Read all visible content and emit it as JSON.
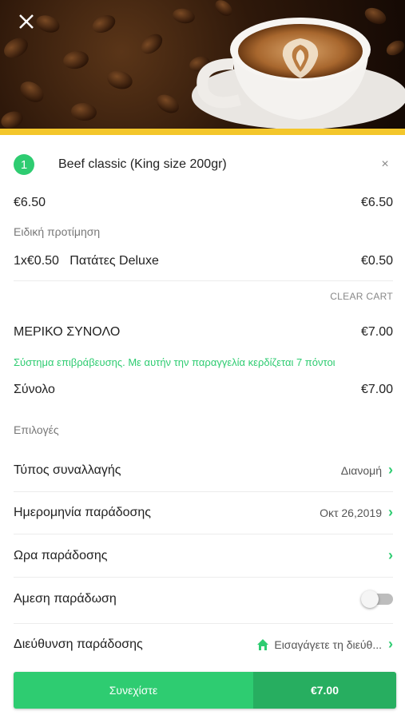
{
  "header": {
    "close_icon": "close-icon",
    "image_alt": "coffee cup with latte art"
  },
  "cart": {
    "badge_count": "1",
    "item_title": "Beef classic (King size 200gr)",
    "remove_symbol": "×",
    "unit_price": "€6.50",
    "line_price": "€6.50",
    "preference_label": "Ειδική προτίμηση",
    "extra_qty_price": "1x€0.50",
    "extra_name": "Πατάτες Deluxe",
    "extra_total": "€0.50",
    "clear_label": "CLEAR CART"
  },
  "summary": {
    "subtotal_label": "ΜΕΡΙΚΟ ΣΥΝΟΛΟ",
    "subtotal_value": "€7.00",
    "loyalty_text": "Σύστημα επιβράβευσης. Με αυτήν την παραγγελία κερδίζεται 7 πόντοι",
    "total_label": "Σύνολο",
    "total_value": "€7.00"
  },
  "options": {
    "section_label": "Επιλογές",
    "transaction_label": "Τύπος συναλλαγής",
    "transaction_value": "Διανομή",
    "date_label": "Ημερομηνία παράδοσης",
    "date_value": "Οκτ 26,2019",
    "time_label": "Ωρα παράδοσης",
    "time_value": "",
    "immediate_label": "Αμεση παράδωση",
    "immediate_on": false,
    "address_label": "Διεύθυνση παράδοσης",
    "address_value": "Εισαγάγετε τη διεύθ..."
  },
  "footer": {
    "continue_label": "Συνεχίστε",
    "total_label": "€7.00"
  },
  "colors": {
    "accent": "#2ecc71",
    "accent_dark": "#27ae60",
    "yellow": "#f3c62b"
  }
}
